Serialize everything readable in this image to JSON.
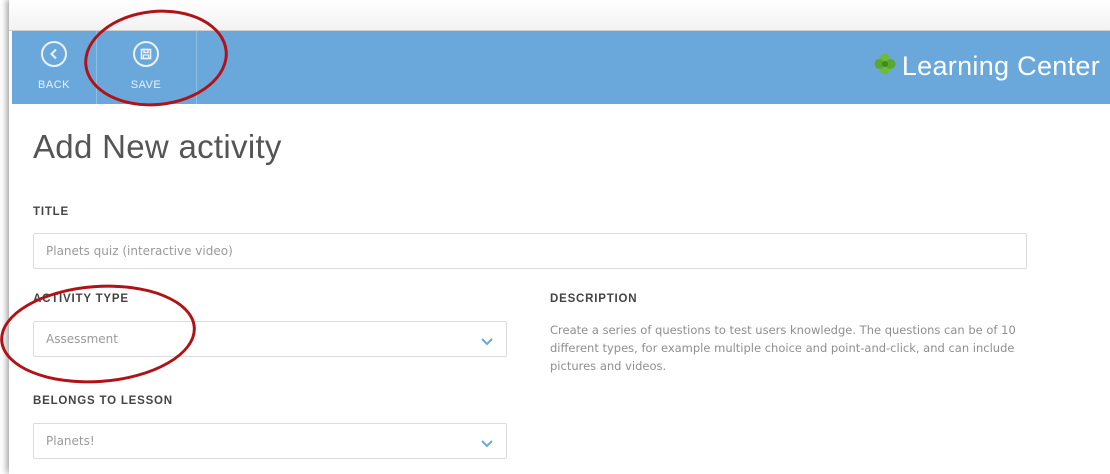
{
  "header": {
    "back_label": "BACK",
    "save_label": "SAVE",
    "brand_name": "Learning Center",
    "bg_color": "#6aa8dc",
    "logo_color": "#6dbb3c"
  },
  "page": {
    "title": "Add New activity"
  },
  "form": {
    "title_label": "TITLE",
    "title_value": "Planets quiz (interactive video)",
    "activity_type_label": "ACTIVITY TYPE",
    "activity_type_value": "Assessment",
    "lesson_label": "BELONGS TO LESSON",
    "lesson_value": "Planets!",
    "description_label": "DESCRIPTION",
    "description_text": "Create a series of questions to test users knowledge. The questions can be of 10 different types, for example multiple choice and point-and-click, and can include pictures and videos."
  },
  "annotation": {
    "color": "#b01217"
  }
}
